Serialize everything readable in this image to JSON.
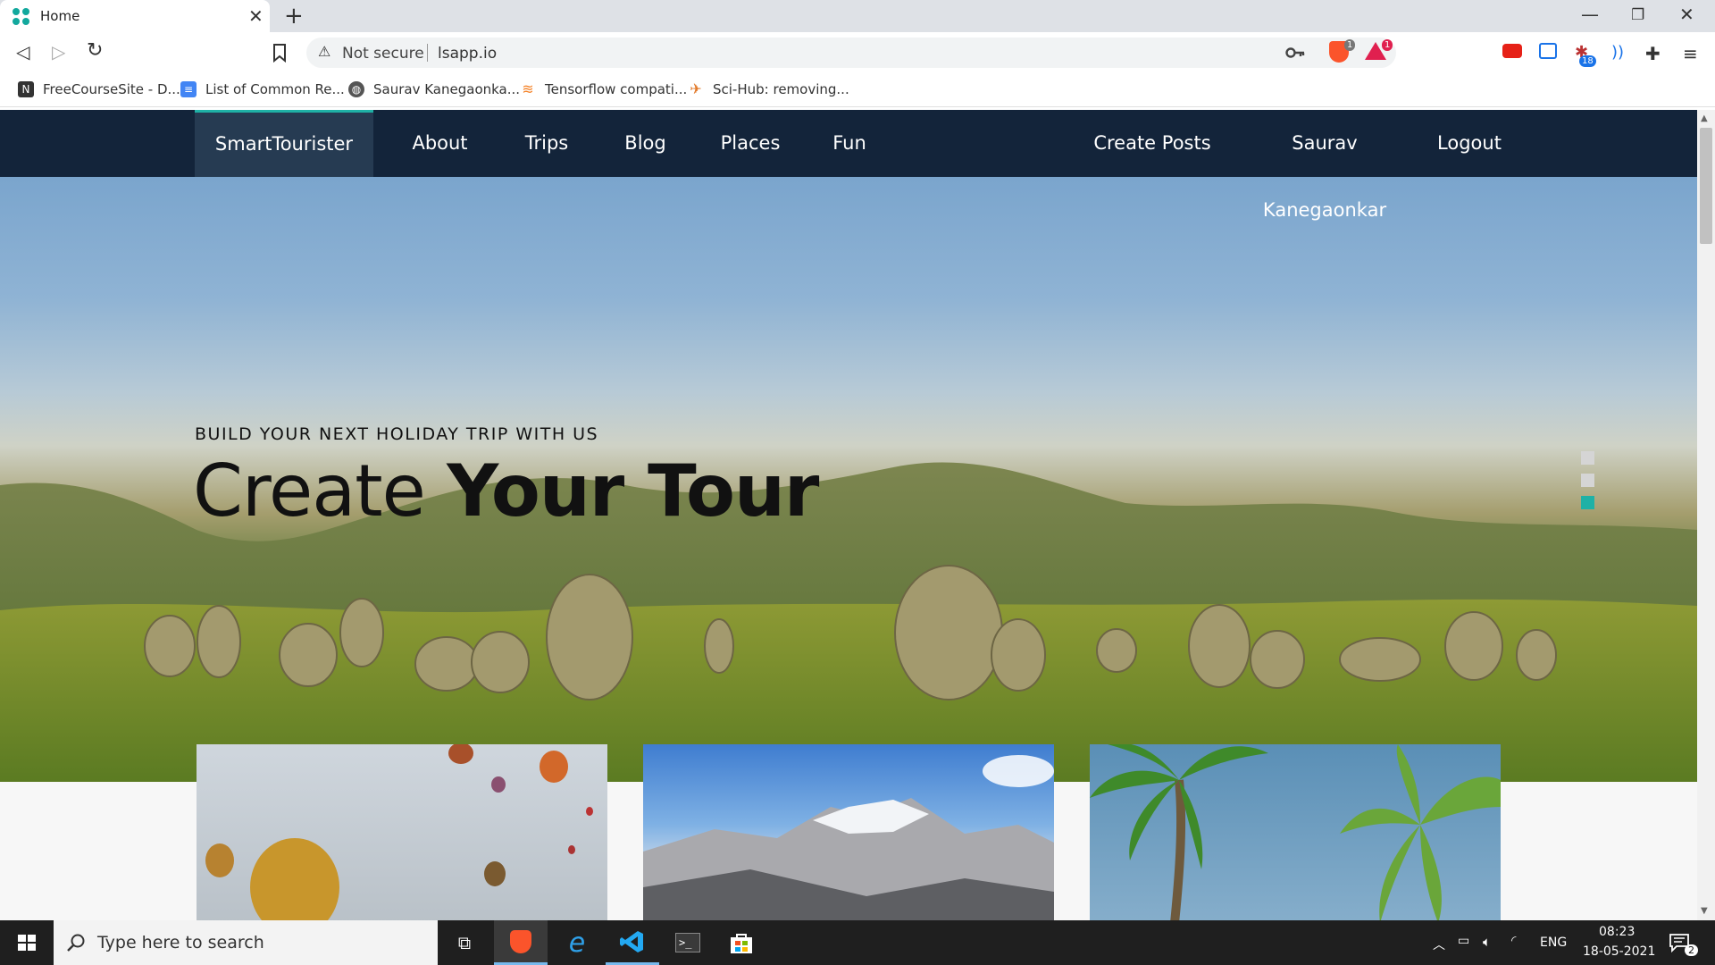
{
  "browser": {
    "tab_title": "Home",
    "not_secure": "Not secure",
    "url": "lsapp.io",
    "brave_shield_badge": "1",
    "brave_rewards_badge": "1",
    "extension_badge": "18"
  },
  "bookmarks": [
    {
      "label": "FreeCourseSite - D...",
      "icon": "fcs-icon",
      "color": "#333333"
    },
    {
      "label": "List of Common Re...",
      "icon": "docs-icon",
      "color": "#4285f4"
    },
    {
      "label": "Saurav Kanegaonka...",
      "icon": "globe-icon",
      "color": "#555555"
    },
    {
      "label": "Tensorflow compati...",
      "icon": "stackoverflow-icon",
      "color": "#f48024"
    },
    {
      "label": "Sci-Hub: removing...",
      "icon": "scihub-icon",
      "color": "#e27b2c"
    }
  ],
  "site": {
    "brand": "SmartTourister",
    "nav_left": [
      "About",
      "Trips",
      "Blog",
      "Places",
      "Fun"
    ],
    "nav_right": [
      "Create Posts",
      "Saurav Kanegaonkar",
      "Logout"
    ],
    "hero_kicker": "BUILD YOUR NEXT HOLIDAY TRIP WITH US",
    "hero_title_light": "Create",
    "hero_title_bold": "Your Tour",
    "slider_active_index": 2,
    "accent_color": "#1fb1a6",
    "navbar_color": "#13243a"
  },
  "taskbar": {
    "search_placeholder": "Type here to search",
    "language": "ENG",
    "time": "08:23",
    "date": "18-05-2021",
    "notification_count": "2"
  }
}
